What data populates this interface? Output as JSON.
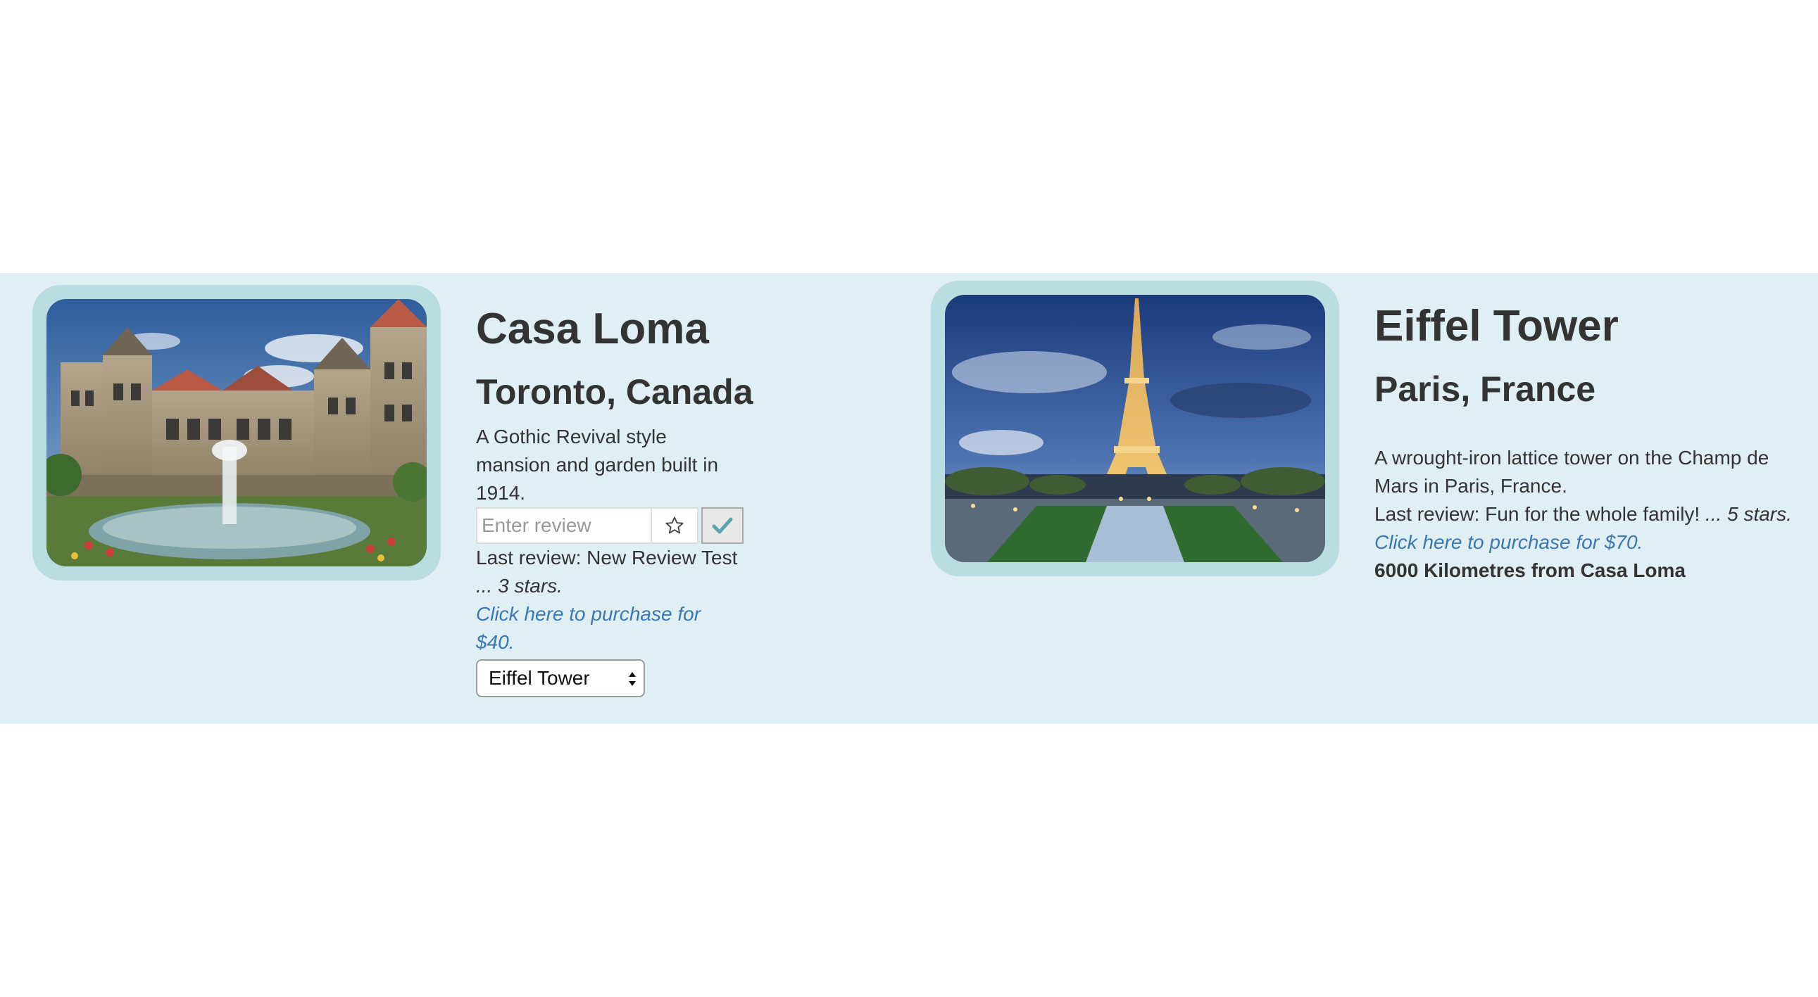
{
  "cards": [
    {
      "title": "Casa Loma",
      "location": "Toronto, Canada",
      "description": "A Gothic Revival style mansion and garden built in 1914.",
      "review_placeholder": "Enter review",
      "last_review_prefix": "Last review: New Review Test",
      "last_review_stars": "... 3 stars.",
      "purchase_link": "Click here to purchase for $40.",
      "select_value": "Eiffel Tower"
    },
    {
      "title": "Eiffel Tower",
      "location": "Paris, France",
      "description": "A wrought-iron lattice tower on the Champ de Mars in Paris, France.",
      "last_review_prefix": "Last review: Fun for the whole family!",
      "last_review_stars": "... 5 stars.",
      "purchase_link": "Click here to purchase for $70.",
      "distance": "6000 Kilometres from Casa Loma"
    }
  ],
  "icons": {
    "star": "star-outline-icon",
    "check": "checkmark-icon",
    "select_arrows": "updown-arrows-icon"
  },
  "colors": {
    "band": "#e0eff4",
    "frame": "#badde2",
    "link": "#3a78b5",
    "check": "#5aa4ae"
  }
}
